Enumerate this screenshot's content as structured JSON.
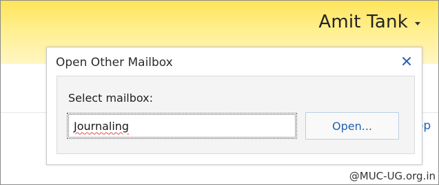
{
  "header": {
    "user_name": "Amit Tank",
    "user_menu_icon": "chevron-down-icon"
  },
  "background": {
    "partial_link_text": "op"
  },
  "dialog": {
    "title": "Open Other Mailbox",
    "close_icon": "close-icon",
    "close_color": "#2b5fb0",
    "select_label": "Select mailbox:",
    "mailbox_value": "Journaling",
    "open_button_label": "Open..."
  },
  "watermark": {
    "text": "@MUC-UG.org.in"
  },
  "colors": {
    "top_bar": "#ffe45a",
    "accent": "#2161b0"
  }
}
